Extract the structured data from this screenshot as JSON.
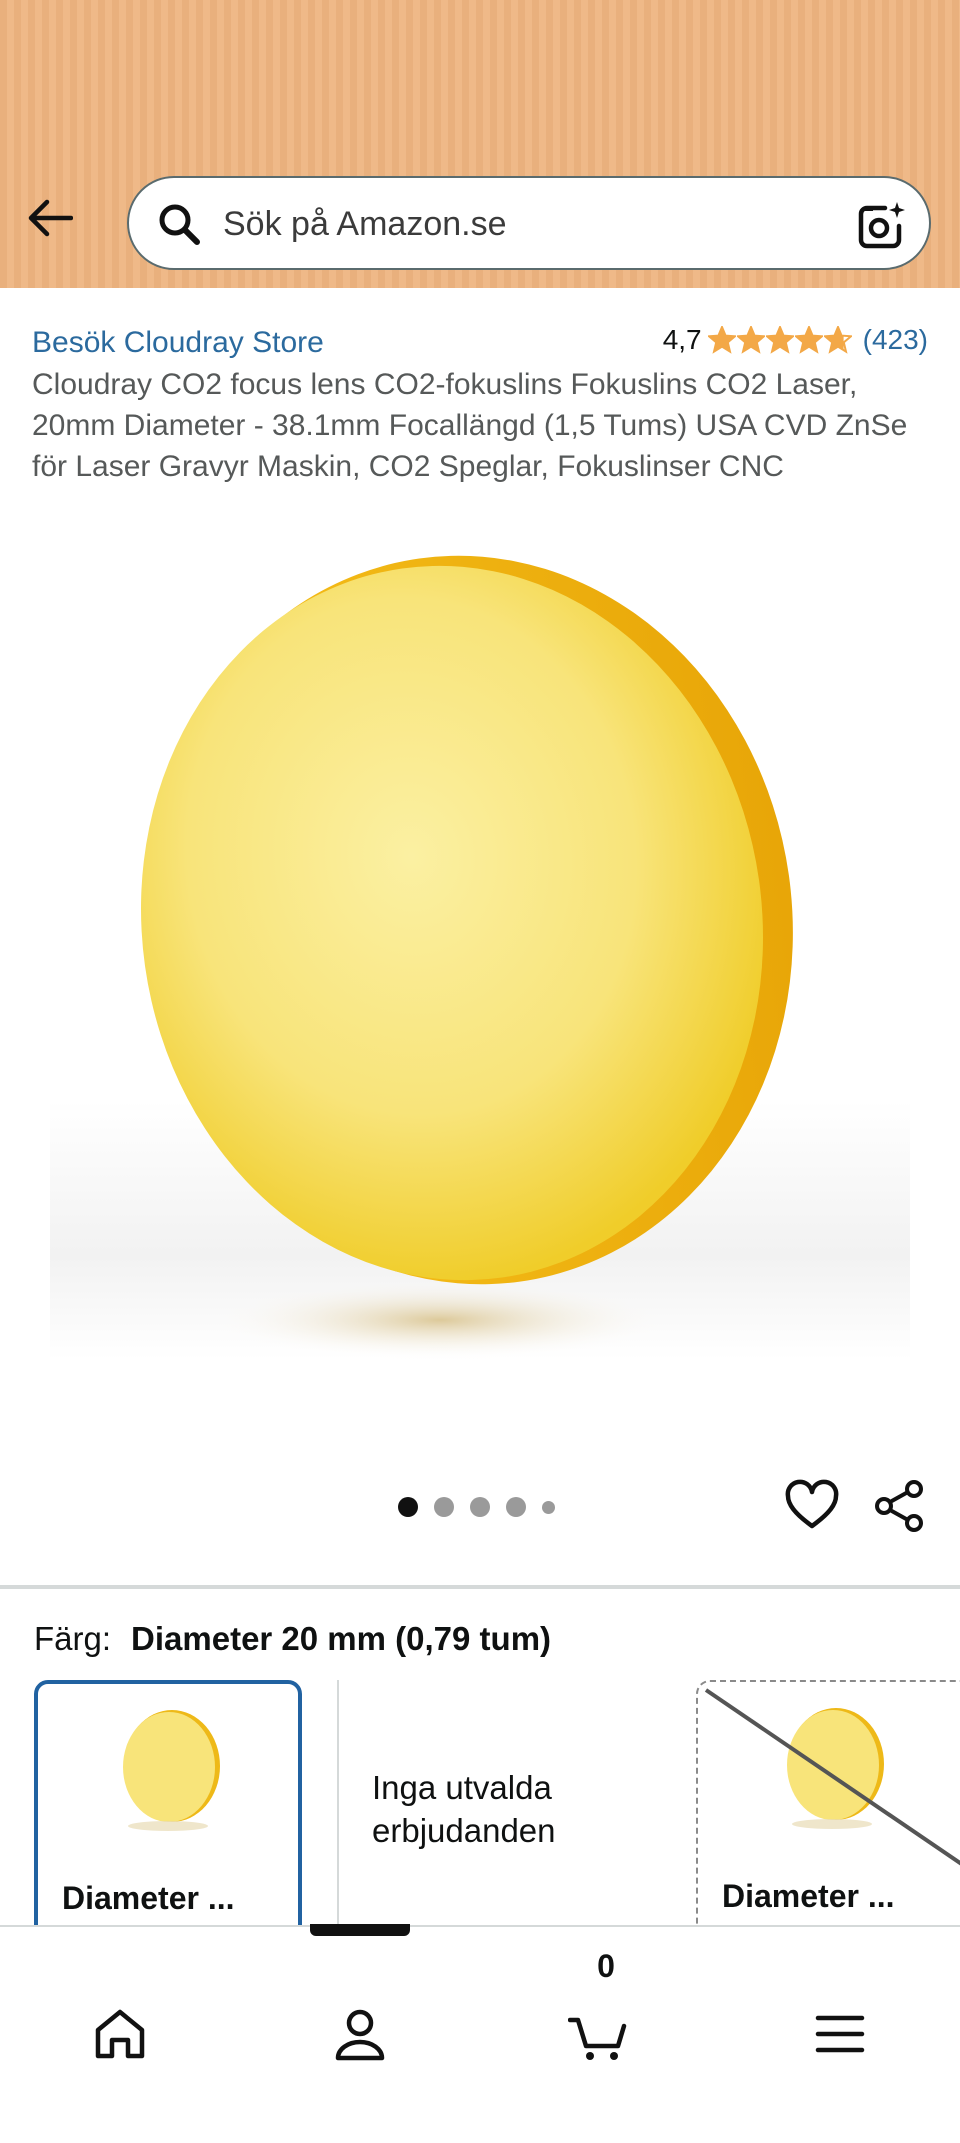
{
  "header": {
    "search_placeholder": "Sök på Amazon.se",
    "icons": [
      "back-arrow-icon",
      "search-icon",
      "camera-icon"
    ]
  },
  "product": {
    "store_link": "Besök Cloudray Store",
    "rating_value": "4,7",
    "rating_stars": 4.7,
    "rating_count": "(423)",
    "title": "Cloudray CO2 focus lens CO2-fokuslins Fokuslins CO2 Laser, 20mm Diameter - 38.1mm Focallängd (1,5 Tums) USA CVD ZnSe för Laser Gravyr Maskin, CO2 Speglar, Fokuslinser CNC"
  },
  "gallery": {
    "image_count": 5,
    "active_index": 0
  },
  "variants": {
    "label": "Färg:",
    "selected_value": "Diameter 20 mm (0,79 tum)",
    "options": [
      {
        "label": "Diameter ...",
        "selected": true
      },
      {
        "label": "Inga utvalda erbjudanden"
      },
      {
        "label": "Diameter ...",
        "unavailable": true
      }
    ]
  },
  "bottom_nav": {
    "cart_count": "0",
    "icons": [
      "home-icon",
      "account-icon",
      "cart-icon",
      "menu-icon"
    ]
  },
  "colors": {
    "header_bg": "#e9b07d",
    "link": "#2b6a9e",
    "star": "#f3a847",
    "selected_border": "#2162a1"
  }
}
